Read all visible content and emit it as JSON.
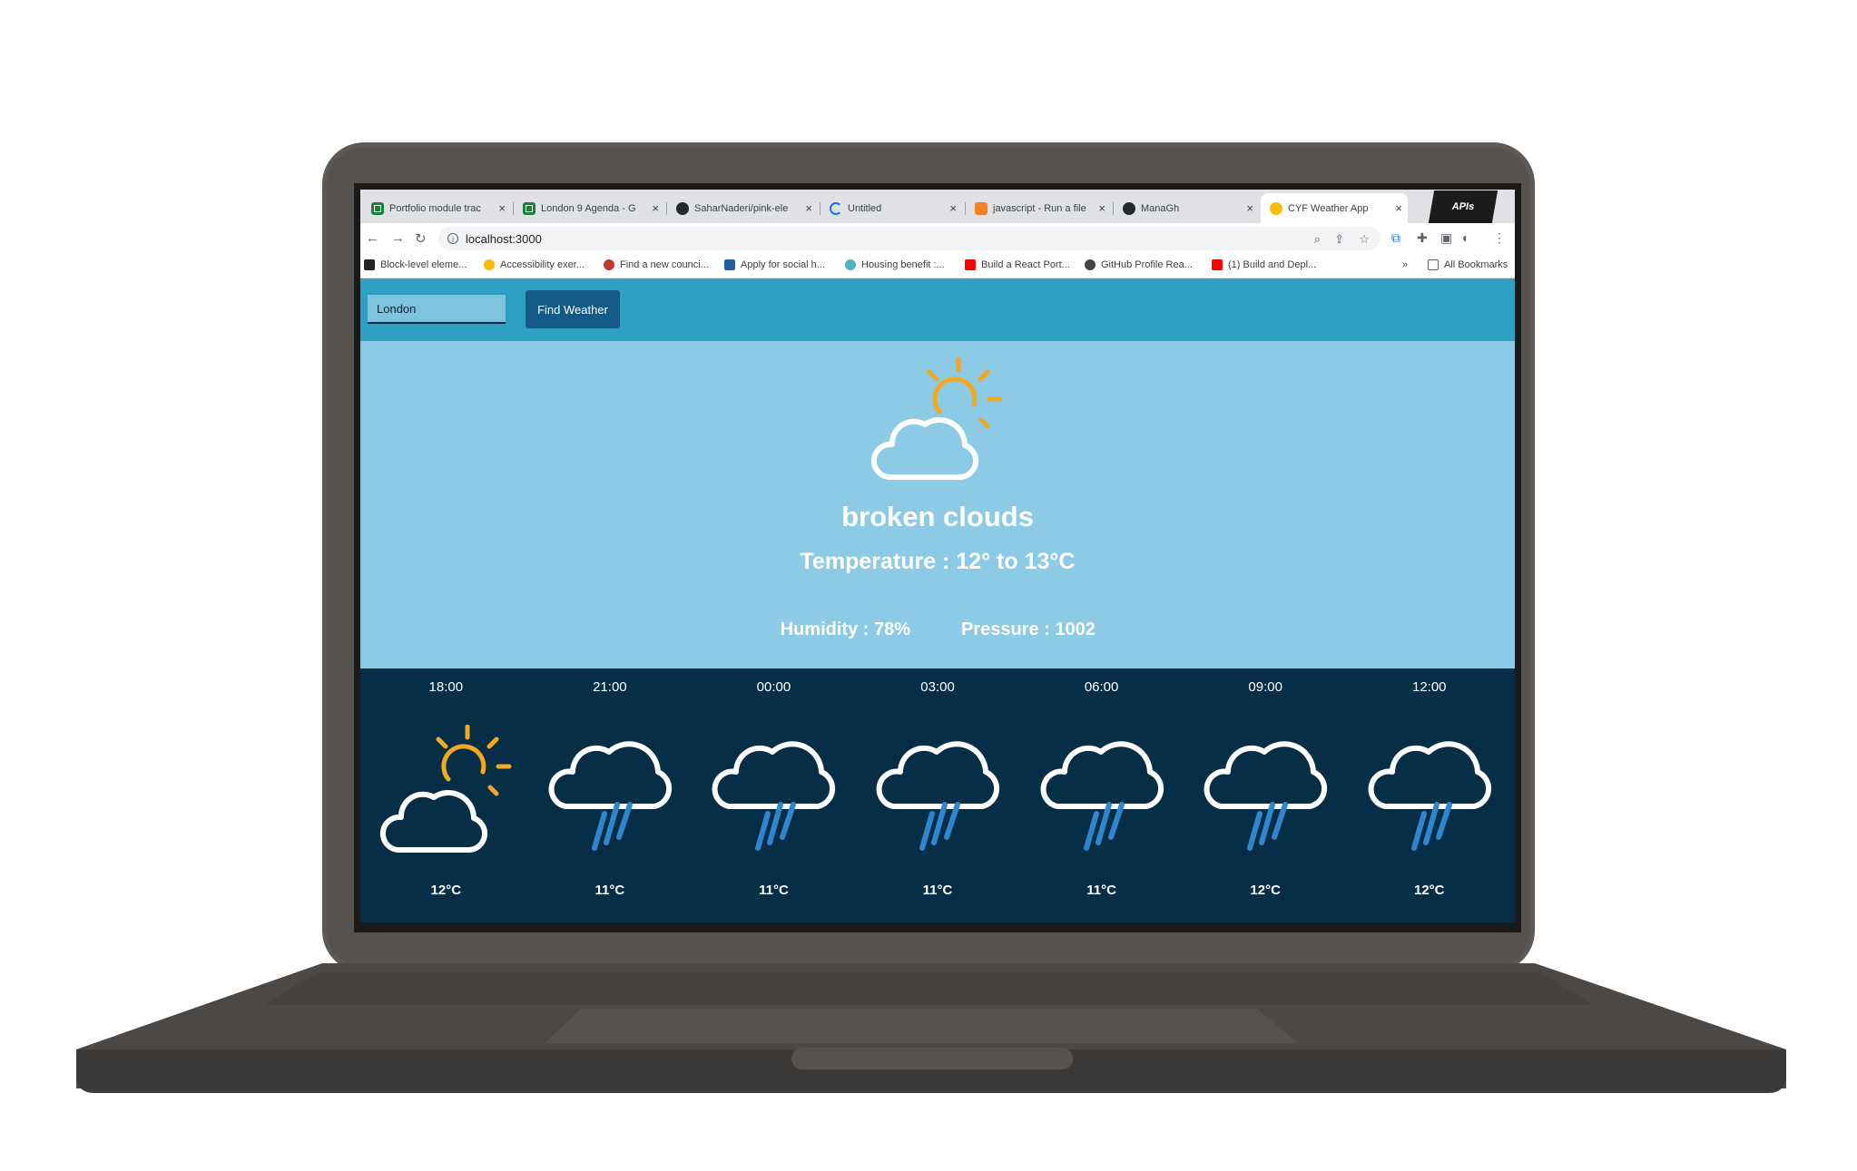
{
  "browser": {
    "tabs": [
      {
        "title": "Portfolio module trac",
        "favicon": "sheets-icon"
      },
      {
        "title": "London 9 Agenda - G",
        "favicon": "sheets-icon"
      },
      {
        "title": "SaharNaderi/pink-ele",
        "favicon": "github-icon"
      },
      {
        "title": "Untitled",
        "favicon": "loading-icon"
      },
      {
        "title": "javascript - Run a file",
        "favicon": "stackoverflow-icon"
      },
      {
        "title": "ManaGh",
        "favicon": "github-icon"
      },
      {
        "title": "CYF Weather App",
        "favicon": "cyf-icon",
        "active": true
      }
    ],
    "close_glyph": "×",
    "badge_text": "APIs",
    "address": "localhost:3000",
    "bookmarks": [
      "Block-level eleme...",
      "Accessibility exer...",
      "Find a new counci...",
      "Apply for social h...",
      "Housing benefit :...",
      "Build a React Port...",
      "GitHub Profile Rea...",
      "(1) Build and Depl..."
    ],
    "bookmarks_overflow": "»",
    "all_bookmarks": "All Bookmarks"
  },
  "app": {
    "city_value": "London",
    "find_button": "Find Weather",
    "current": {
      "description": "broken clouds",
      "temperature": "Temperature : 12° to 13°C",
      "humidity": "Humidity : 78%",
      "pressure": "Pressure : 1002",
      "icon": "cloud-sun-icon"
    },
    "forecast": [
      {
        "time": "18:00",
        "temp": "12°C",
        "icon": "cloud-sun-icon"
      },
      {
        "time": "21:00",
        "temp": "11°C",
        "icon": "rain-icon"
      },
      {
        "time": "00:00",
        "temp": "11°C",
        "icon": "rain-icon"
      },
      {
        "time": "03:00",
        "temp": "11°C",
        "icon": "rain-icon"
      },
      {
        "time": "06:00",
        "temp": "11°C",
        "icon": "rain-icon"
      },
      {
        "time": "09:00",
        "temp": "12°C",
        "icon": "rain-icon"
      },
      {
        "time": "12:00",
        "temp": "12°C",
        "icon": "rain-icon"
      }
    ]
  },
  "colors": {
    "header_bar": "#2ea0c2",
    "current_bg": "#8dcae6",
    "forecast_bg": "#062e47",
    "button": "#135a86",
    "sun": "#f2a91f",
    "rain": "#2f86cf"
  }
}
